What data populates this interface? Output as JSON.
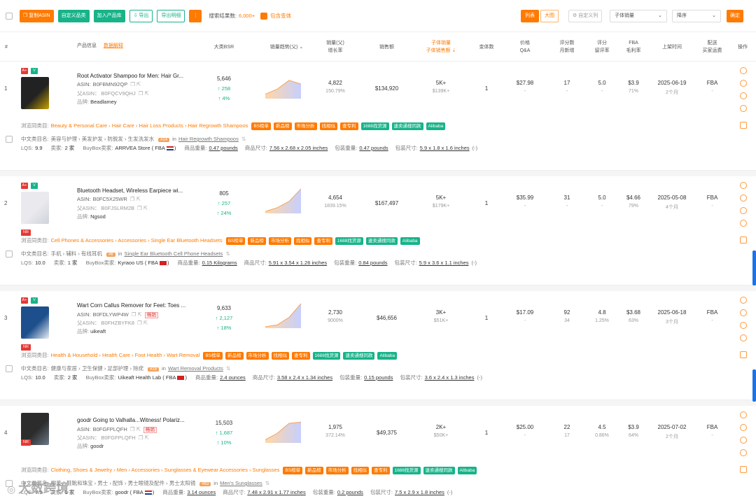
{
  "toolbar": {
    "buttons": [
      "复制ASIN",
      "自定义品类",
      "加入产品库",
      "导出",
      "导出明细",
      "⋮"
    ],
    "search_count_label": "搜索结果数:",
    "search_count_value": "6,000+",
    "include_variants_label": "包含变体",
    "view_list": "列表",
    "view_grid": "大图",
    "custom_columns": "自定义列",
    "sort_field": "子体销量",
    "sort_order": "降序",
    "confirm": "确定"
  },
  "header": {
    "index": "#",
    "product_info": "产品信息",
    "data_explain": "数据解释",
    "bsr": "大类BSR",
    "trend": "销量趋势(父)",
    "sales_growth_1": "销量(父)",
    "sales_growth_2": "增长率",
    "revenue": "销售额",
    "child_sales_1": "子体销量",
    "child_sales_2": "子体销售额",
    "variants": "变体数",
    "price_1": "价格",
    "price_2": "Q&A",
    "reviews_1": "评分数",
    "reviews_2": "月新增",
    "rating_1": "评分",
    "rating_2": "留评率",
    "fba_1": "FBA",
    "fba_2": "毛利率",
    "launch": "上架时间",
    "delivery_1": "配送",
    "delivery_2": "买家运费",
    "ops": "操作"
  },
  "labels": {
    "asin": "ASIN:",
    "parent_asin": "父ASIN：",
    "brand": "品牌:",
    "browse": "浏览同类目:",
    "cn_category": "中文类目名:",
    "in": "in",
    "lqs": "LQS:",
    "sellers": "卖家:",
    "buybox": "BuyBox卖家:",
    "weight": "商品重量:",
    "size": "商品尺寸:",
    "pkg_weight": "包装重量:",
    "pkg_size": "包装尺寸:",
    "dash": "-",
    "minus": "(-)",
    "hot": "畅销"
  },
  "pill_labels": [
    "BS榜单",
    "新品榜",
    "市场分析",
    "找相似",
    "查专利",
    "1688找货源",
    "速卖通搜同款",
    "Alibaba"
  ],
  "products": [
    {
      "index": "1",
      "badges": [
        "A+",
        "V"
      ],
      "title": "Root Activator Shampoo for Men: Hair Gr...",
      "asin": "B0FBMN92QP",
      "parent_asin": "B0FQCV9QHJ",
      "brand": "Beadlamey",
      "hot": false,
      "nr": false,
      "bsr": "5,646",
      "bsr_delta": "258",
      "bsr_pct": "4%",
      "sales": "4,822",
      "growth": "150.79%",
      "revenue": "$134,920",
      "child_sales": "5K+",
      "child_revenue": "$139K+",
      "variants": "1",
      "price": "$27.98",
      "qa": "-",
      "reviews": "17",
      "reviews_new": "-",
      "rating": "5.0",
      "review_rate": "-",
      "fba": "$3.9",
      "margin": "71%",
      "launch": "2025-06-19",
      "age": "2个月",
      "delivery": "FBA",
      "shipping": "-",
      "browse_path": "Beauty & Personal Care › Hair Care › Hair Loss Products › Hair Regrowth Shampoos",
      "cn_path": "美容与护理 › 美发护发 › 防脱发 › 生发洗发水",
      "rank_badge": "#14",
      "rank_cat": "Hair Regrowth Shampoos",
      "lqs": "9.9",
      "sellers": "2 家",
      "buybox": "ARRVEA Store ( FBA",
      "weight": "0.47 pounds",
      "size": "7.56 x 2.68 x 2.05 inches",
      "pkg_weight": "0.47 pounds",
      "pkg_size": "5.9 x 1.8 x 1.6 inches",
      "trend": [
        0.15,
        0.35,
        0.7,
        0.55
      ],
      "flag": "us"
    },
    {
      "index": "2",
      "badges": [
        "A+",
        "V"
      ],
      "title": "Bluetooth Headset, Wireless Earpiece wi...",
      "asin": "B0FC5X25WR",
      "parent_asin": "B0FJSLRM2B",
      "brand": "Ngsod",
      "hot": false,
      "nr": true,
      "bsr": "805",
      "bsr_delta": "257",
      "bsr_pct": "24%",
      "sales": "4,654",
      "growth": "1839.15%",
      "revenue": "$167,497",
      "child_sales": "5K+",
      "child_revenue": "$179K+",
      "variants": "1",
      "price": "$35.99",
      "qa": "-",
      "reviews": "31",
      "reviews_new": "-",
      "rating": "5.0",
      "review_rate": "-",
      "fba": "$4.66",
      "margin": "79%",
      "launch": "2025-05-08",
      "age": "4个月",
      "delivery": "FBA",
      "shipping": "-",
      "browse_path": "Cell Phones & Accessories › Accessories › Single Ear Bluetooth Headsets",
      "cn_path": "手机 › 辅料 › 有线耳机",
      "rank_badge": "#6",
      "rank_cat": "Single Ear Bluetooth Cell Phone Headsets",
      "lqs": "10.0",
      "sellers": "1 家",
      "buybox": "Kyraoo US ( FBA",
      "weight": "0.15 Kilograms",
      "size": "5.91 x 3.54 x 1.26 inches",
      "pkg_weight": "0.84 pounds",
      "pkg_size": "5.9 x 3.6 x 1.1 inches",
      "trend": [
        0.05,
        0.2,
        0.45,
        0.95
      ],
      "flag": "cn"
    },
    {
      "index": "3",
      "badges": [
        "A+",
        "V"
      ],
      "title": "Wart Corn Callus Remover for Feet: Toes ...",
      "asin": "B0FDLYWP4W",
      "parent_asin": "B0FHZBYFK8",
      "brand": "uikeaft",
      "hot": true,
      "nr": true,
      "bsr": "9,633",
      "bsr_delta": "2,127",
      "bsr_pct": "18%",
      "sales": "2,730",
      "growth": "9000%",
      "revenue": "$46,656",
      "child_sales": "3K+",
      "child_revenue": "$51K+",
      "variants": "1",
      "price": "$17.09",
      "qa": "-",
      "reviews": "92",
      "reviews_new": "34",
      "rating": "4.8",
      "review_rate": "1.25%",
      "fba": "$3.68",
      "margin": "63%",
      "launch": "2025-06-18",
      "age": "3个月",
      "delivery": "FBA",
      "shipping": "-",
      "browse_path": "Health & Household › Health Care › Foot Health › Wart Removal",
      "cn_path": "健康与家居 › 卫生保健 › 足部护理 › 除疣",
      "rank_badge": "#18",
      "rank_cat": "Wart Removal Products",
      "lqs": "10.0",
      "sellers": "2 家",
      "buybox": "Uikeaft Health Lab ( FBA",
      "weight": "2.4 ounces",
      "size": "3.58 x 2.4 x 1.34 inches",
      "pkg_weight": "0.15 pounds",
      "pkg_size": "3.6 x 2.4 x 1.3 inches",
      "trend": [
        0.03,
        0.1,
        0.4,
        0.95
      ],
      "flag": "cn"
    },
    {
      "index": "4",
      "badges": [],
      "title": "goodr Going to Valhalla...Witness! Polariz...",
      "asin": "B0FGFPLQFH",
      "parent_asin": "B0FGFPLQFH",
      "brand": "goodr",
      "hot": true,
      "nr": true,
      "bsr": "15,503",
      "bsr_delta": "1,687",
      "bsr_pct": "10%",
      "sales": "1,975",
      "growth": "372.14%",
      "revenue": "$49,375",
      "child_sales": "2K+",
      "child_revenue": "$50K+",
      "variants": "1",
      "price": "$25.00",
      "qa": "-",
      "reviews": "22",
      "reviews_new": "17",
      "rating": "4.5",
      "review_rate": "0.86%",
      "fba": "$3.9",
      "margin": "64%",
      "launch": "2025-07-02",
      "age": "2个月",
      "delivery": "FBA",
      "shipping": "-",
      "browse_path": "Clothing, Shoes & Jewelry › Men › Accessories › Sunglasses & Eyewear Accessories › Sunglasses",
      "cn_path": "服装、鞋靴和珠宝 › 男士 › 配饰 › 男士眼镜及配件 › 男士太阳镜",
      "rank_badge": "#63",
      "rank_cat": "Men's Sunglasses",
      "lqs": "7.9",
      "sellers": "1 家",
      "buybox": "goodr ( FBA",
      "weight": "3.14 ounces",
      "size": "7.48 x 2.91 x 1.77 inches",
      "pkg_weight": "0.2 pounds",
      "pkg_size": "7.5 x 2.9 x 1.8 inches",
      "trend": [
        0.1,
        0.35,
        0.75,
        0.8
      ],
      "flag": "us"
    }
  ],
  "watermark": "大数跨境",
  "colors": {
    "accent": "#ff7a00",
    "green": "#18b389",
    "blue": "#1a73e8"
  }
}
